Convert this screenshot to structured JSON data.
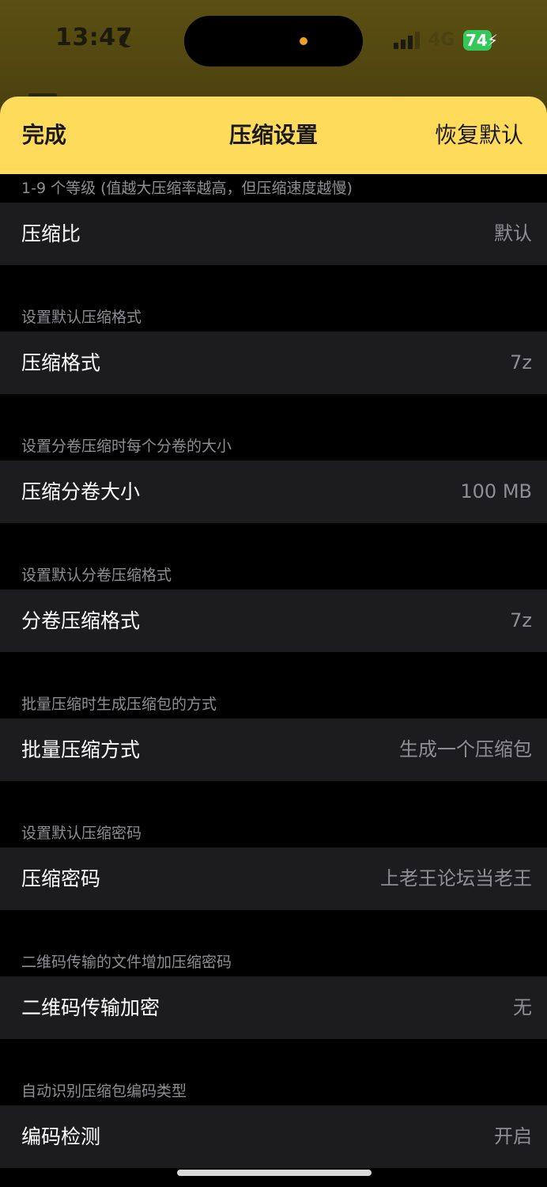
{
  "status_bar": {
    "time": "13:47",
    "network": "4G",
    "battery": "74"
  },
  "nav": {
    "done_label": "完成",
    "title": "压缩设置",
    "restore_label": "恢复默认"
  },
  "sections": [
    {
      "header": "1-9 个等级 (值越大压缩率越高，但压缩速度越慢)",
      "label": "压缩比",
      "value": "默认"
    },
    {
      "header": "设置默认压缩格式",
      "label": "压缩格式",
      "value": "7z"
    },
    {
      "header": "设置分卷压缩时每个分卷的大小",
      "label": "压缩分卷大小",
      "value": "100 MB"
    },
    {
      "header": "设置默认分卷压缩格式",
      "label": "分卷压缩格式",
      "value": "7z"
    },
    {
      "header": "批量压缩时生成压缩包的方式",
      "label": "批量压缩方式",
      "value": "生成一个压缩包"
    },
    {
      "header": "设置默认压缩密码",
      "label": "压缩密码",
      "value": "上老王论坛当老王"
    },
    {
      "header": "二维码传输的文件增加压缩密码",
      "label": "二维码传输加密",
      "value": "无"
    },
    {
      "header": "自动识别压缩包编码类型",
      "label": "编码检测",
      "value": "开启"
    }
  ],
  "colors": {
    "nav_background": "#fedb5b",
    "row_background": "#1c1c1e",
    "secondary_text": "#8e8e93",
    "battery_green": "#34c759"
  }
}
